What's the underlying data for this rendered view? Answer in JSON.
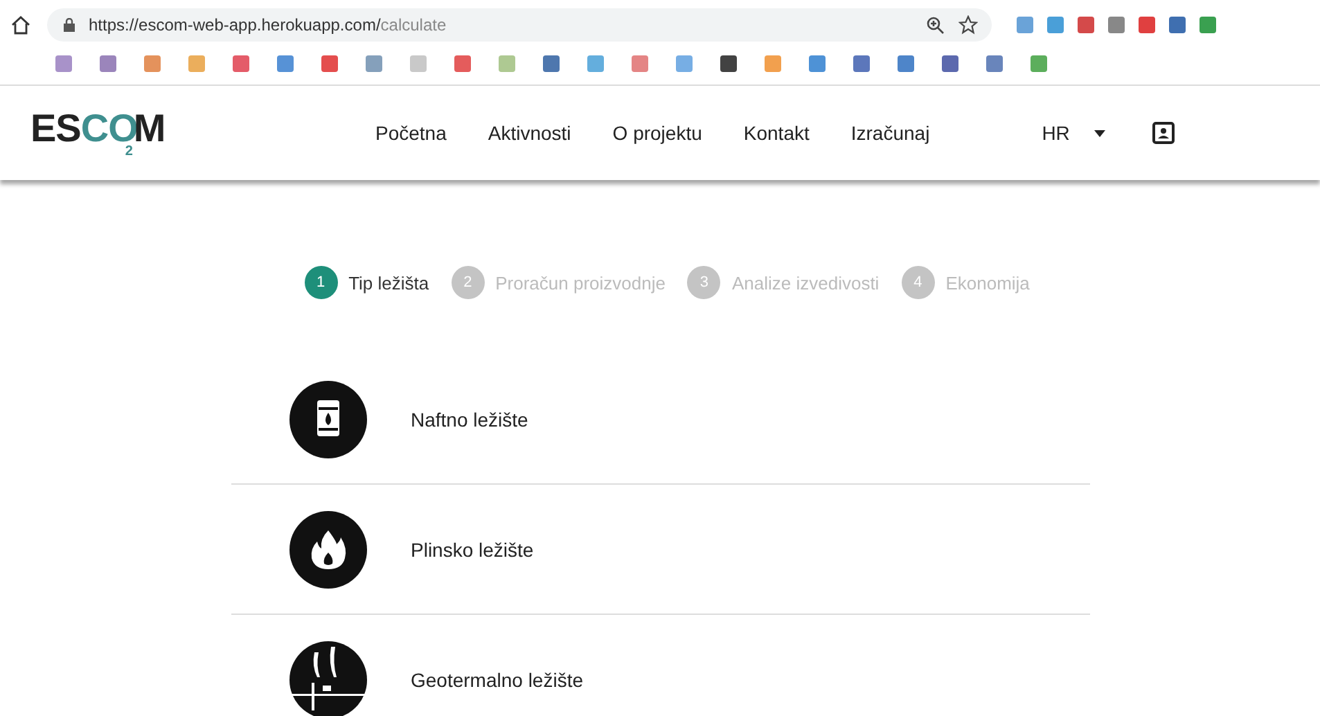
{
  "browser": {
    "url_host": "https://escom-web-app.herokuapp.com/",
    "url_path": "calculate"
  },
  "logo": [
    {
      "text": "ES",
      "kind": "plain"
    },
    {
      "text": "CO",
      "kind": "accent"
    },
    {
      "text": "2",
      "kind": "sub"
    },
    {
      "text": "M",
      "kind": "plain"
    }
  ],
  "nav": {
    "items": [
      "Početna",
      "Aktivnosti",
      "O projektu",
      "Kontakt",
      "Izračunaj"
    ],
    "language": "HR"
  },
  "steps": [
    {
      "number": "1",
      "label": "Tip ležišta",
      "selected": true
    },
    {
      "number": "2",
      "label": "Proračun proizvodnje",
      "selected": false
    },
    {
      "number": "3",
      "label": "Analize izvedivosti",
      "selected": false
    },
    {
      "number": "4",
      "label": "Ekonomija",
      "selected": false
    }
  ],
  "reservoirs": [
    {
      "label": "Naftno ležište",
      "kind": "oil"
    },
    {
      "label": "Plinsko ležište",
      "kind": "gas"
    },
    {
      "label": "Geotermalno ležište",
      "kind": "geothermal"
    }
  ]
}
